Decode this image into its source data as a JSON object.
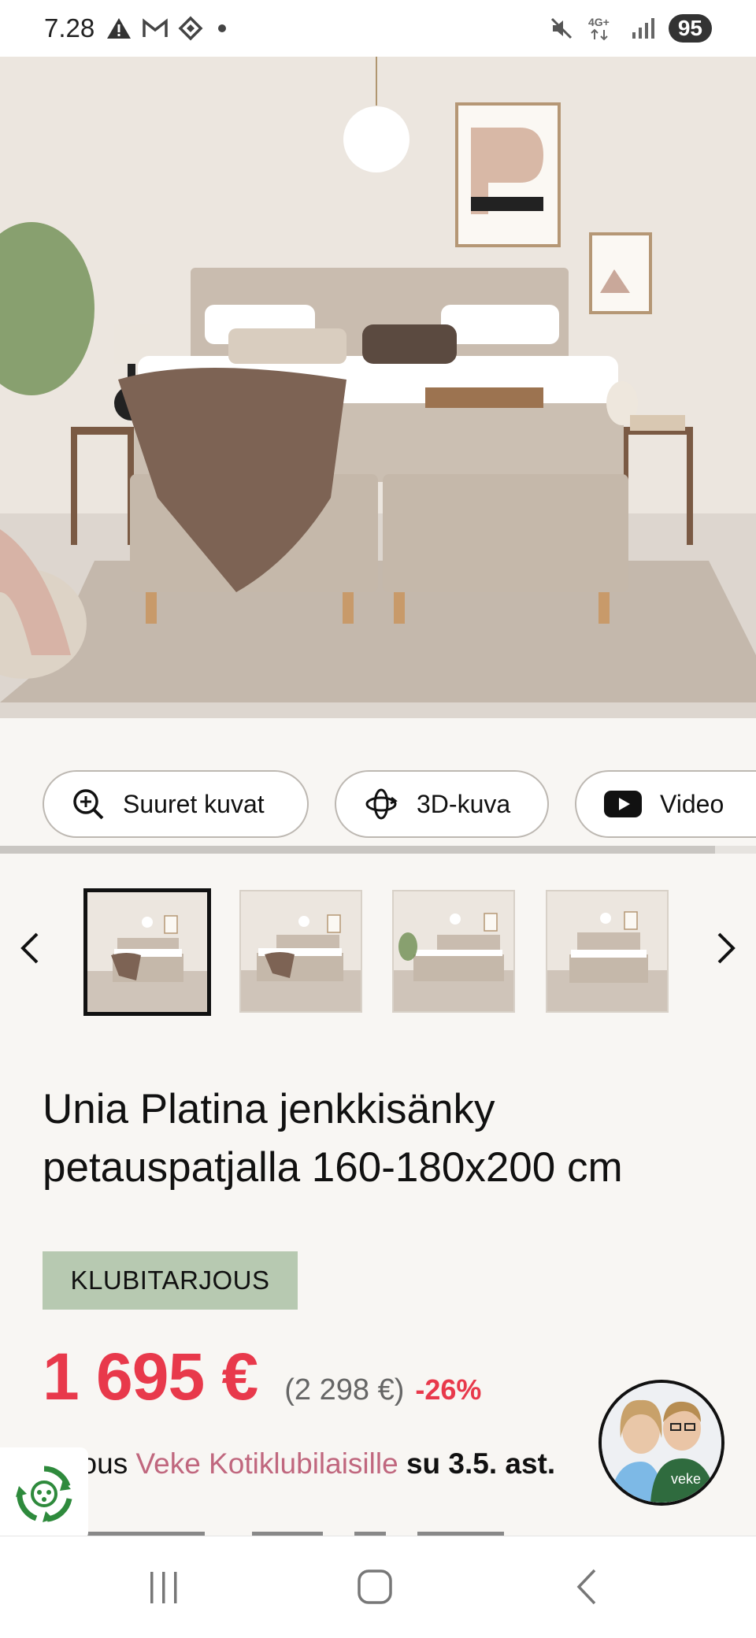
{
  "status_bar": {
    "time": "7.28",
    "network": "4G+",
    "battery": "95",
    "icons": [
      "alert-icon",
      "gmail-icon",
      "diamond-app-icon",
      "dot-icon",
      "mute-icon",
      "signal-icon"
    ]
  },
  "media_buttons": [
    {
      "label": "Suuret kuvat",
      "icon": "zoom-in-icon"
    },
    {
      "label": "3D-kuva",
      "icon": "rotate-3d-icon"
    },
    {
      "label": "Video",
      "icon": "youtube-icon"
    }
  ],
  "thumbnails": {
    "count": 4,
    "active_index": 0,
    "prev_icon": "chevron-left-icon",
    "next_icon": "chevron-right-icon"
  },
  "product": {
    "title": "Unia Platina jenkkisänky petauspatjalla 160-180x200 cm",
    "badge": "KLUBITARJOUS",
    "price_now": "1 695 €",
    "price_old": "(2 298 €)",
    "discount": "-26%",
    "offer_prefix": "rjous",
    "offer_link": "Veke Kotiklubilaisille",
    "offer_date": "su 3.5. ast."
  },
  "chat_avatar": {
    "logo_text": "veke"
  },
  "colors": {
    "accent_red": "#e8394b",
    "badge_green": "#b7c9b1",
    "link_pink": "#c0677e",
    "background": "#f8f6f3"
  },
  "nav_bar": {
    "buttons": [
      "recent-apps-icon",
      "home-icon",
      "back-icon"
    ]
  }
}
